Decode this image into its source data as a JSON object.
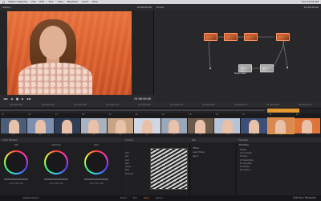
{
  "menubar": {
    "apple": "",
    "items": [
      "DaVinci Resolve",
      "File",
      "Edit",
      "Trim",
      "View",
      "Playback",
      "Color",
      "Help"
    ],
    "status": "Sun 10:32 AM"
  },
  "viewer": {
    "header_left": "Gallery",
    "header_timecode": "01:00:00:00",
    "timecode": "01:00:00:00",
    "controls": [
      "◀◀",
      "◀",
      "■",
      "▶",
      "▶▶"
    ]
  },
  "node_editor": {
    "header_left": "Nodes",
    "header_timecode": "01:00:00:00",
    "node_label": "Node Label"
  },
  "timeline": {
    "ruler": [
      "01:00:00:00",
      "01:00:00:12",
      "01:00:01:00",
      "01:00:01:12",
      "01:00:02:00",
      "01:00:02:12",
      "01:00:03:00",
      "01:00:03:12",
      "01:00:04:00",
      "01:00:04:12"
    ]
  },
  "clips": {
    "header": [
      "01",
      "02",
      "03",
      "04",
      "05",
      "06",
      "07",
      "08",
      "09",
      "10",
      "11",
      "12"
    ],
    "labels": [
      "V1",
      "V1",
      "V1",
      "V1",
      "V1",
      "V1",
      "V1",
      "V1",
      "V1",
      "V1",
      "V1",
      "V1"
    ],
    "colors": [
      "#4b5d78",
      "#7d8fb0",
      "#2f3f57",
      "#aab2c0",
      "#c7a483",
      "#cfd6e4",
      "#9aa6ba",
      "#6b5a4a",
      "#b7c3d6",
      "#3b4f79",
      "#d98a51",
      "#e0743b"
    ]
  },
  "bottom": {
    "wheels_title": "Color Wheels",
    "wheels": [
      {
        "label": "Lift",
        "values": "0.00  0.00  0.00"
      },
      {
        "label": "Gamma",
        "values": "0.00  0.00  0.00"
      },
      {
        "label": "Gain",
        "values": "1.00  1.00  1.00"
      }
    ],
    "curve_title": "Curves",
    "curve_rows": [
      "Hue",
      "Sat",
      "Lum",
      "Red",
      "Green",
      "Blue",
      "",
      "Soft Clip"
    ],
    "info_title": "Key",
    "info_rows": [
      "Offset",
      "Layer Mixer",
      "Input"
    ],
    "nodes_title": "Timeline",
    "nodes_rows": [
      "Master",
      "01 Contrast",
      "02 Skin",
      "03 Saturation",
      "04 Vignette",
      "05 Grade",
      "06 Output"
    ]
  },
  "footer": {
    "project": "Untitled Project",
    "tabs": [
      "Media",
      "Edit",
      "Color",
      "Deliver"
    ],
    "active_tab": "Color",
    "brand": "DaVinci Resolve"
  }
}
